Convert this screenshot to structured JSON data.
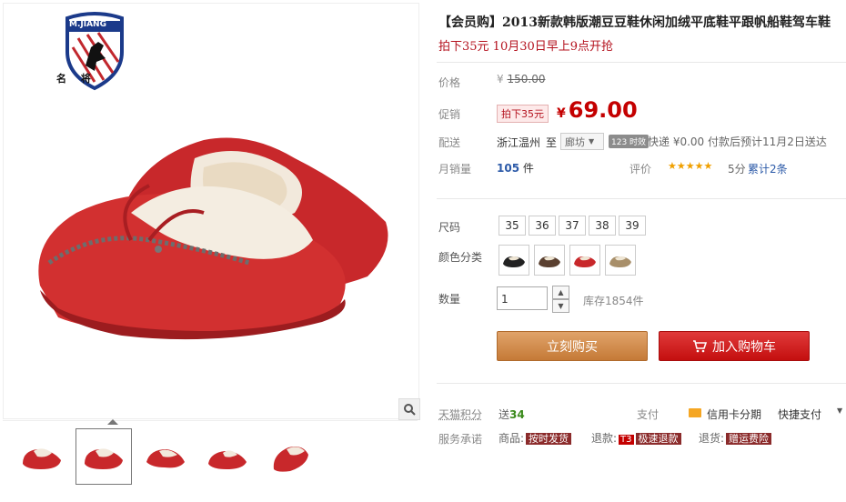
{
  "brand": {
    "logo_text": "M.JIANG",
    "logo_cn": "名 将"
  },
  "title": "【会员购】2013新款韩版潮豆豆鞋休闲加绒平底鞋平跟帆船鞋驾车鞋",
  "subtitle": "拍下35元 10月30日早上9点开抢",
  "price_section": {
    "orig_label": "价格",
    "orig_currency": "¥",
    "orig_value": "150.00",
    "promo_label": "促销",
    "promo_badge": "拍下35元",
    "promo_currency": "¥",
    "promo_value": "69.00"
  },
  "delivery": {
    "label": "配送",
    "from": "浙江温州",
    "to_word": "至",
    "to_city": "廊坊",
    "badge": "123 时效",
    "detail": "快递 ¥0.00  付款后预计11月2日送达"
  },
  "sales": {
    "label": "月销量",
    "count": "105",
    "unit": "件",
    "rating_label": "评价",
    "stars": "★★★★★",
    "score": "5分",
    "reviews": "累计2条"
  },
  "sizes": {
    "label": "尺码",
    "options": [
      "35",
      "36",
      "37",
      "38",
      "39"
    ]
  },
  "colors": {
    "label": "颜色分类",
    "swatches": [
      "black",
      "brown",
      "red",
      "khaki"
    ]
  },
  "quantity": {
    "label": "数量",
    "value": "1",
    "stock": "库存1854件"
  },
  "buttons": {
    "buy": "立刻购买",
    "cart": "加入购物车"
  },
  "points": {
    "label": "天猫积分",
    "prefix": "送",
    "value": "34"
  },
  "payment": {
    "label": "支付",
    "credit": "信用卡分期",
    "quick": "快捷支付"
  },
  "service": {
    "label": "服务承诺",
    "goods_prefix": "商品:",
    "goods_tag": "按时发货",
    "refund_prefix": "退款:",
    "refund_t3": "T3",
    "refund_tag": "极速退款",
    "return_prefix": "退货:",
    "return_tag": "赠运费险"
  },
  "colors_theme": {
    "accent_red": "#c40000",
    "buy_orange": "#c57a37"
  }
}
